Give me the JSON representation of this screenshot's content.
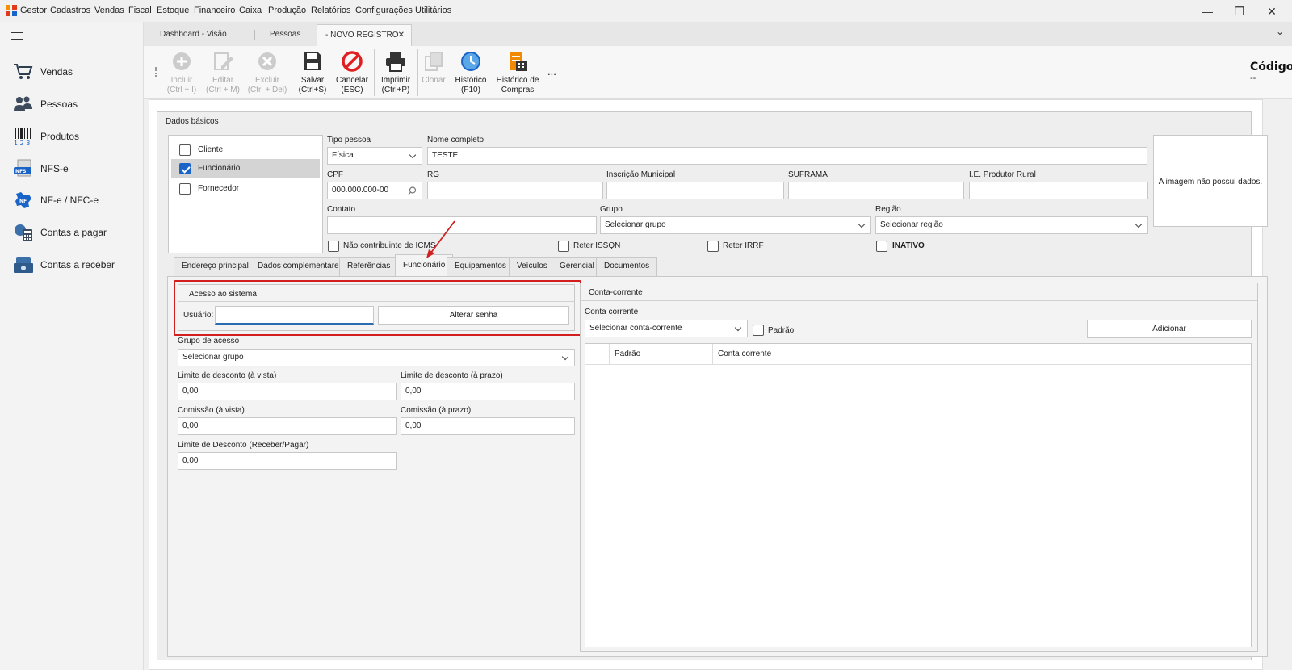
{
  "app": {
    "title": "Gestor",
    "menu": [
      "Cadastros",
      "Vendas",
      "Fiscal",
      "Estoque",
      "Financeiro",
      "Caixa",
      "Produção",
      "Relatórios",
      "Configurações",
      "Utilitários"
    ]
  },
  "window_controls": {
    "minimize": "—",
    "maximize": "❐",
    "close": "✕",
    "expand": "⌄"
  },
  "sidebar": {
    "items": [
      {
        "label": "Vendas",
        "icon": "cart-icon"
      },
      {
        "label": "Pessoas",
        "icon": "people-icon"
      },
      {
        "label": "Produtos",
        "icon": "barcode-icon"
      },
      {
        "label": "NFS-e",
        "icon": "nfse-icon"
      },
      {
        "label": "NF-e / NFC-e",
        "icon": "nfe-icon"
      },
      {
        "label": "Contas a pagar",
        "icon": "calculator-icon"
      },
      {
        "label": "Contas a receber",
        "icon": "money-icon"
      }
    ]
  },
  "tabs": [
    {
      "label": "Dashboard - Visão Geral"
    },
    {
      "label": "Pessoas"
    },
    {
      "label": "- NOVO REGISTRO",
      "close": "✕"
    }
  ],
  "toolbar": {
    "buttons": [
      {
        "line1": "Incluir",
        "line2": "(Ctrl + I)",
        "icon": "plus-circle-icon",
        "enabled": false
      },
      {
        "line1": "Editar",
        "line2": "(Ctrl + M)",
        "icon": "edit-icon",
        "enabled": false
      },
      {
        "line1": "Excluir",
        "line2": "(Ctrl + Del)",
        "icon": "delete-circle-icon",
        "enabled": false
      },
      {
        "line1": "Salvar",
        "line2": "(Ctrl+S)",
        "icon": "save-icon",
        "enabled": true
      },
      {
        "line1": "Cancelar",
        "line2": "(ESC)",
        "icon": "cancel-icon",
        "enabled": true
      },
      {
        "line1": "Imprimir",
        "line2": "(Ctrl+P)",
        "icon": "print-icon",
        "enabled": true
      },
      {
        "line1": "Clonar",
        "line2": "",
        "icon": "clone-icon",
        "enabled": false
      },
      {
        "line1": "Histórico",
        "line2": "(F10)",
        "icon": "history-icon",
        "enabled": true
      },
      {
        "line1": "Histórico de",
        "line2": "Compras",
        "icon": "purchase-history-icon",
        "enabled": true
      }
    ],
    "more": "...",
    "codigo_label": "Código",
    "codigo_value": "--"
  },
  "dados_basicos": {
    "title": "Dados básicos",
    "roles": [
      {
        "label": "Cliente",
        "checked": false
      },
      {
        "label": "Funcionário",
        "checked": true
      },
      {
        "label": "Fornecedor",
        "checked": false
      }
    ],
    "tipo_pessoa_label": "Tipo pessoa",
    "tipo_pessoa_value": "Física",
    "nome_label": "Nome completo",
    "nome_value": "TESTE",
    "cpf_label": "CPF",
    "cpf_value": "000.000.000-00",
    "rg_label": "RG",
    "im_label": "Inscrição Municipal",
    "suframa_label": "SUFRAMA",
    "ie_label": "I.E. Produtor Rural",
    "contato_label": "Contato",
    "grupo_label": "Grupo",
    "grupo_value": "Selecionar grupo",
    "regiao_label": "Região",
    "regiao_value": "Selecionar região",
    "nao_contribuinte": "Não contribuinte de ICMS",
    "reter_issqn": "Reter ISSQN",
    "reter_irrf": "Reter IRRF",
    "inativo": "INATIVO",
    "imagem_text": "A imagem não possui dados."
  },
  "inner_tabs": [
    "Endereço principal",
    "Dados complementares",
    "Referências",
    "Funcionário",
    "Equipamentos",
    "Veículos",
    "Gerencial",
    "Documentos"
  ],
  "funcionario": {
    "acesso_title": "Acesso ao sistema",
    "usuario_label": "Usuário:",
    "usuario_value": "",
    "alterar_senha": "Alterar senha",
    "grupo_acesso_label": "Grupo de acesso",
    "grupo_acesso_value": "Selecionar grupo",
    "lim_vista_label": "Limite de desconto (à vista)",
    "lim_vista_value": "0,00",
    "lim_prazo_label": "Limite de desconto (à prazo)",
    "lim_prazo_value": "0,00",
    "com_vista_label": "Comissão (à vista)",
    "com_vista_value": "0,00",
    "com_prazo_label": "Comissão (à prazo)",
    "com_prazo_value": "0,00",
    "lim_rp_label": "Limite de Desconto (Receber/Pagar)",
    "lim_rp_value": "0,00"
  },
  "conta_corrente": {
    "title": "Conta-corrente",
    "label": "Conta corrente",
    "select_value": "Selecionar conta-corrente",
    "padrao_label": "Padrão",
    "adicionar": "Adicionar",
    "columns": [
      "Padrão",
      "Conta corrente"
    ]
  },
  "colors": {
    "accent": "#1a64c8",
    "highlight": "#d11e1e",
    "cancel_red": "#e02020"
  }
}
